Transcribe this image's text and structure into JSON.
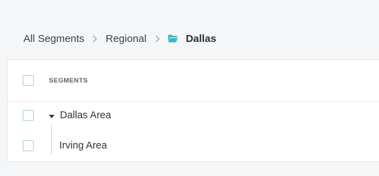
{
  "breadcrumb": {
    "items": [
      "All Segments",
      "Regional"
    ],
    "current": "Dallas",
    "folder_icon_color": "#3fb3c4"
  },
  "table": {
    "column_header": "SEGMENTS",
    "rows": [
      {
        "label": "Dallas Area",
        "expanded": true
      },
      {
        "label": "Irving Area",
        "expanded": false
      }
    ]
  }
}
